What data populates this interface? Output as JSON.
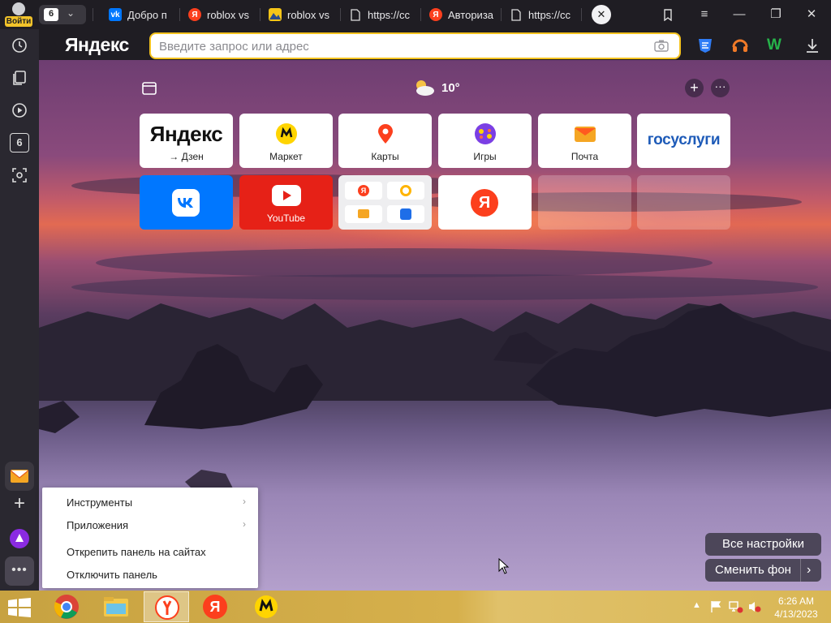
{
  "profile": {
    "label": "Войти"
  },
  "tab_count": "6",
  "tabs": [
    {
      "label": "Добро п",
      "fav": "VK",
      "color": "#0077ff"
    },
    {
      "label": "roblox vs",
      "fav": "Я",
      "color": "#fc3f1d"
    },
    {
      "label": "roblox vs",
      "fav": "",
      "color": "#f5c518"
    },
    {
      "label": "https://cc",
      "fav": "",
      "color": ""
    },
    {
      "label": "Авториза",
      "fav": "Я",
      "color": "#fc3f1d"
    },
    {
      "label": "https://cc",
      "fav": "",
      "color": ""
    }
  ],
  "browser": {
    "logo": "Яндекс",
    "search_placeholder": "Введите запрос или адрес"
  },
  "weather": {
    "temp": "10°"
  },
  "tiles_row1": [
    {
      "title": "Яндекс",
      "caption": "→ Дзен"
    },
    {
      "caption": "Маркет"
    },
    {
      "caption": "Карты"
    },
    {
      "caption": "Игры"
    },
    {
      "caption": "Почта"
    },
    {
      "title": "госуслуги"
    }
  ],
  "tiles_row2": [
    {
      "caption": "VK"
    },
    {
      "caption": "YouTube"
    },
    {
      "caption": "group"
    },
    {
      "caption": "Я"
    }
  ],
  "context_menu": {
    "items": [
      "Инструменты",
      "Приложения",
      "Открепить панель на сайтах",
      "Отключить панель"
    ]
  },
  "buttons": {
    "all_settings": "Все настройки",
    "change_bg": "Сменить фон"
  },
  "clock": {
    "time": "6:26 AM",
    "date": "4/13/2023"
  },
  "colors": {
    "accent": "#f3c21f",
    "yandex_red": "#fc3f1d",
    "vk_blue": "#0077ff",
    "youtube_red": "#e62117"
  }
}
